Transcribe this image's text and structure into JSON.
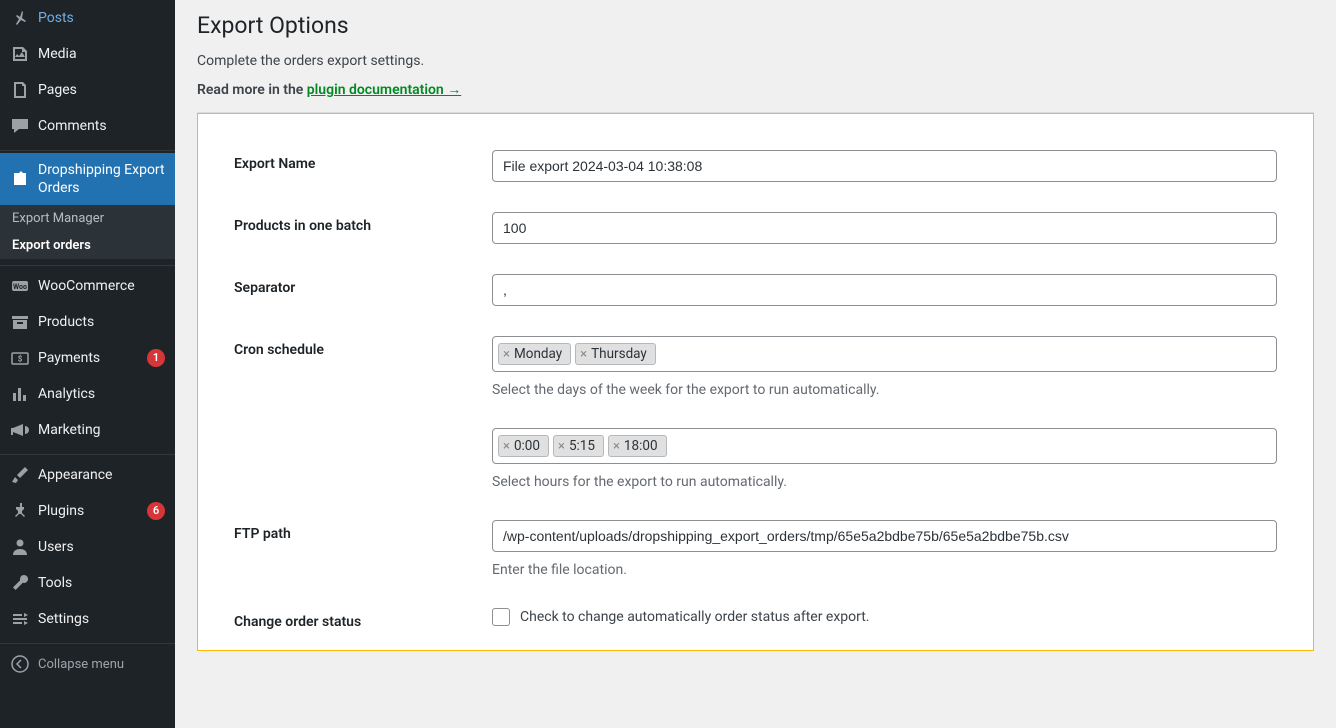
{
  "sidebar": {
    "items": [
      {
        "label": "Posts",
        "icon": "pin"
      },
      {
        "label": "Media",
        "icon": "media"
      },
      {
        "label": "Pages",
        "icon": "page"
      },
      {
        "label": "Comments",
        "icon": "comment"
      }
    ],
    "active": {
      "label": "Dropshipping Export Orders",
      "icon": "export"
    },
    "submenu": [
      {
        "label": "Export Manager"
      },
      {
        "label": "Export orders"
      }
    ],
    "items2": [
      {
        "label": "WooCommerce",
        "icon": "woo"
      },
      {
        "label": "Products",
        "icon": "archive"
      },
      {
        "label": "Payments",
        "icon": "payments",
        "badge": "1"
      },
      {
        "label": "Analytics",
        "icon": "analytics"
      },
      {
        "label": "Marketing",
        "icon": "megaphone"
      }
    ],
    "items3": [
      {
        "label": "Appearance",
        "icon": "brush"
      },
      {
        "label": "Plugins",
        "icon": "plug",
        "badge": "6"
      },
      {
        "label": "Users",
        "icon": "user"
      },
      {
        "label": "Tools",
        "icon": "wrench"
      },
      {
        "label": "Settings",
        "icon": "settings"
      }
    ],
    "collapse": "Collapse menu"
  },
  "page": {
    "title": "Export Options",
    "subtitle": "Complete the orders export settings.",
    "readmore_prefix": "Read more in the ",
    "readmore_link": "plugin documentation →"
  },
  "form": {
    "export_name": {
      "label": "Export Name",
      "value": "File export 2024-03-04 10:38:08"
    },
    "batch": {
      "label": "Products in one batch",
      "value": "100"
    },
    "separator": {
      "label": "Separator",
      "value": ","
    },
    "cron": {
      "label": "Cron schedule",
      "days": [
        "Monday",
        "Thursday"
      ],
      "days_help": "Select the days of the week for the export to run automatically.",
      "hours": [
        "0:00",
        "5:15",
        "18:00"
      ],
      "hours_help": "Select hours for the export to run automatically."
    },
    "ftp": {
      "label": "FTP path",
      "value": "/wp-content/uploads/dropshipping_export_orders/tmp/65e5a2bdbe75b/65e5a2bdbe75b.csv",
      "help": "Enter the file location."
    },
    "change_status": {
      "label": "Change order status",
      "check_label": "Check to change automatically order status after export."
    }
  }
}
